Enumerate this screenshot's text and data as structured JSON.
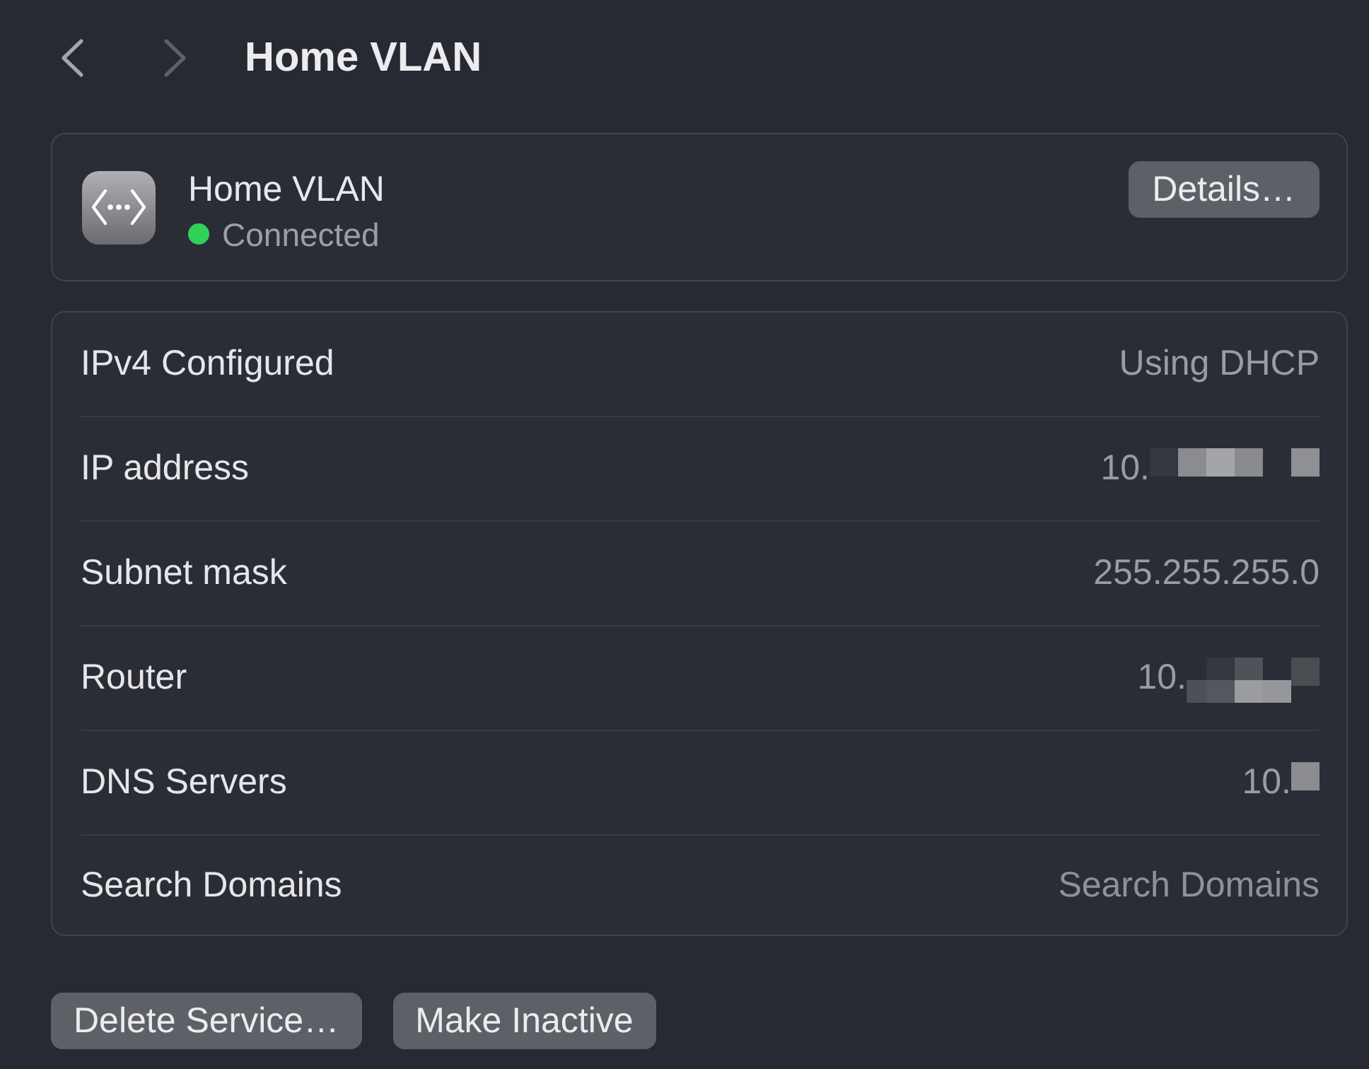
{
  "toolbar": {
    "back": {
      "disabled": false
    },
    "forward": {
      "disabled": true
    },
    "title": "Home VLAN"
  },
  "service": {
    "name": "Home VLAN",
    "status": "Connected",
    "connected": true,
    "details_button": "Details…"
  },
  "settings": [
    {
      "label": "IPv4 Configured",
      "kind": "text",
      "value": "Using DHCP",
      "redacted": false
    },
    {
      "label": "IP address",
      "kind": "text",
      "value": "10.",
      "redacted": true
    },
    {
      "label": "Subnet mask",
      "kind": "text",
      "value": "255.255.255.0",
      "redacted": false
    },
    {
      "label": "Router",
      "kind": "text",
      "value": "10.",
      "redacted": true
    },
    {
      "label": "DNS Servers",
      "kind": "text",
      "value": "10.",
      "redacted": true
    },
    {
      "label": "Search Domains",
      "kind": "field",
      "placeholder": "Search Domains"
    }
  ],
  "buttons": [
    "Delete Service…",
    "Make Inactive"
  ]
}
